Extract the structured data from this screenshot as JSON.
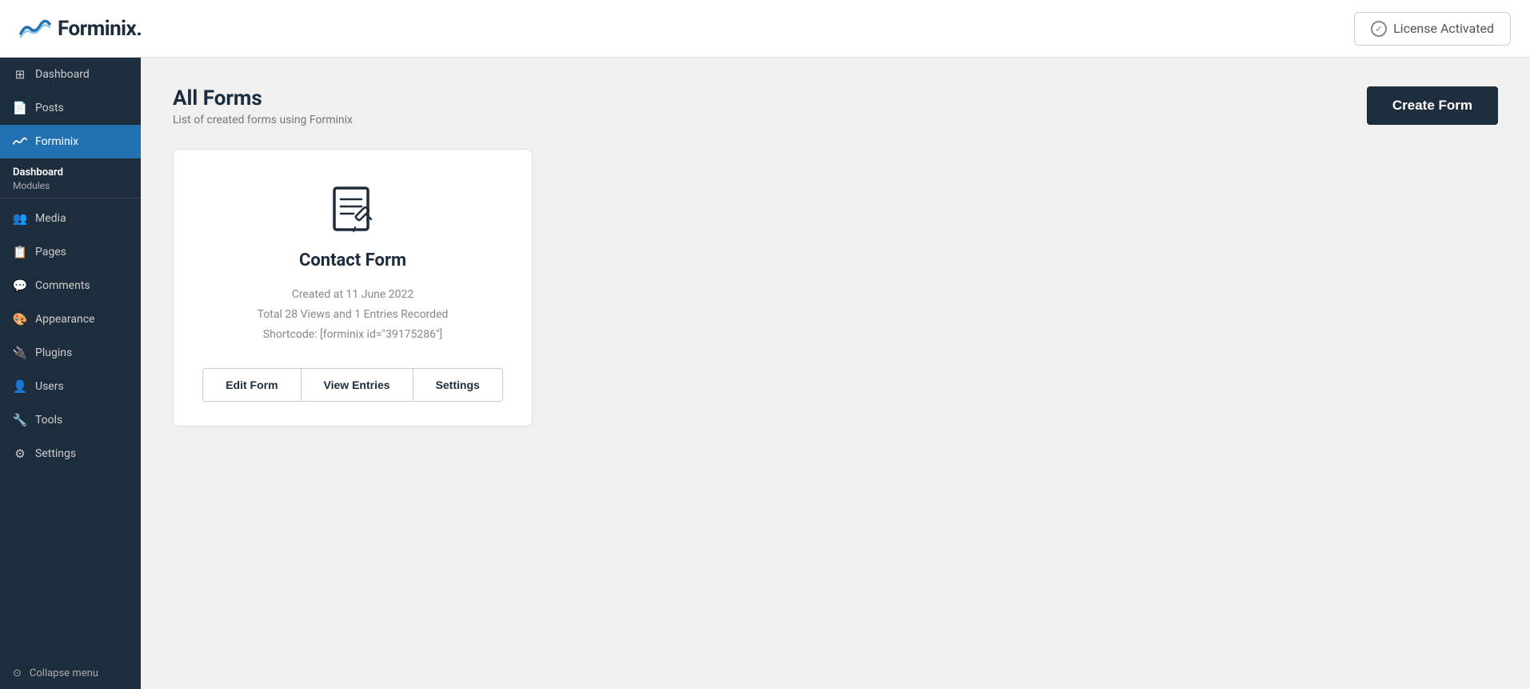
{
  "header": {
    "logo_text": "Forminix.",
    "license_label": "License Activated"
  },
  "sidebar": {
    "items": [
      {
        "id": "dashboard",
        "label": "Dashboard",
        "icon": "⊞",
        "active": false
      },
      {
        "id": "posts",
        "label": "Posts",
        "icon": "📄",
        "active": false
      },
      {
        "id": "forminix",
        "label": "Forminix",
        "icon": "〜",
        "active": true
      },
      {
        "id": "dashboard-modules-header",
        "label": "Dashboard",
        "sublabel": "Modules",
        "type": "section"
      },
      {
        "id": "media",
        "label": "Media",
        "icon": "👥",
        "active": false
      },
      {
        "id": "pages",
        "label": "Pages",
        "icon": "📋",
        "active": false
      },
      {
        "id": "comments",
        "label": "Comments",
        "icon": "💬",
        "active": false
      },
      {
        "id": "appearance",
        "label": "Appearance",
        "icon": "🎨",
        "active": false
      },
      {
        "id": "plugins",
        "label": "Plugins",
        "icon": "🔌",
        "active": false
      },
      {
        "id": "users",
        "label": "Users",
        "icon": "👤",
        "active": false
      },
      {
        "id": "tools",
        "label": "Tools",
        "icon": "🔧",
        "active": false
      },
      {
        "id": "settings",
        "label": "Settings",
        "icon": "⚙",
        "active": false
      }
    ],
    "collapse_label": "Collapse menu"
  },
  "main": {
    "page_title": "All Forms",
    "page_subtitle": "List of created forms using Forminix",
    "create_button_label": "Create Form",
    "form_card": {
      "name": "Contact Form",
      "created": "Created at 11 June 2022",
      "stats": "Total 28 Views and 1 Entries Recorded",
      "shortcode": "Shortcode: [forminix id=\"39175286\"]",
      "actions": [
        {
          "id": "edit-form",
          "label": "Edit Form"
        },
        {
          "id": "view-entries",
          "label": "View Entries"
        },
        {
          "id": "settings",
          "label": "Settings"
        }
      ]
    }
  }
}
